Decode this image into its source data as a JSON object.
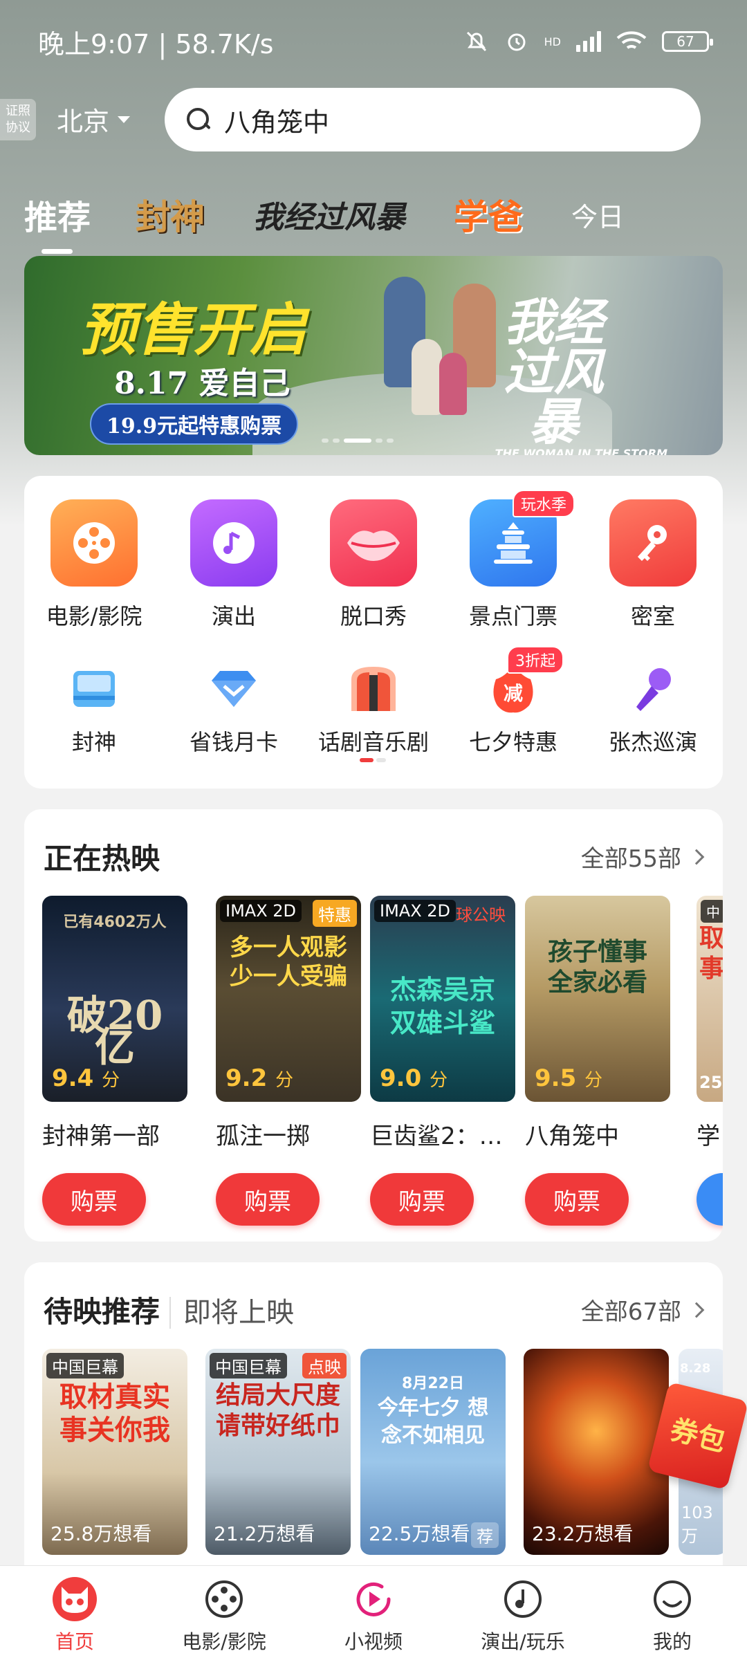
{
  "status_bar": {
    "time": "晚上9:07",
    "speed": "58.7K/s",
    "network": "HD",
    "battery": "67"
  },
  "header": {
    "license_line1": "证照",
    "license_line2": "协议",
    "city": "北京",
    "search_text": "八角笼中"
  },
  "tabs": {
    "active": "推荐",
    "logo1": "封神",
    "logo2": "我经过风暴",
    "logo3": "学爸",
    "today": "今日"
  },
  "banner": {
    "title": "预售开启",
    "subtitle": "8.17 爱自己",
    "price": "19.9元起特惠购票",
    "logo": "我经过风暴",
    "logo_en": "THE WOMAN IN THE STORM"
  },
  "services": {
    "row1": [
      {
        "label": "电影/影院",
        "icon": "film-reel-icon",
        "color": "#ff8a3d"
      },
      {
        "label": "演出",
        "icon": "music-note-icon",
        "color": "#a74ff2"
      },
      {
        "label": "脱口秀",
        "icon": "lips-icon",
        "color": "#f5455c"
      },
      {
        "label": "景点门票",
        "icon": "temple-icon",
        "color": "#3a8cf5",
        "badge": "玩水季"
      },
      {
        "label": "密室",
        "icon": "key-icon",
        "color": "#f2524a"
      }
    ],
    "row2": [
      {
        "label": "封神",
        "icon": "fengshen-icon"
      },
      {
        "label": "省钱月卡",
        "icon": "diamond-icon"
      },
      {
        "label": "话剧音乐剧",
        "icon": "curtain-icon"
      },
      {
        "label": "七夕特惠",
        "icon": "discount-icon",
        "badge": "3折起",
        "glyph": "减"
      },
      {
        "label": "张杰巡演",
        "icon": "microphone-icon"
      }
    ]
  },
  "now_showing": {
    "title": "正在热映",
    "more": "全部55部",
    "movies": [
      {
        "name": "封神第一部",
        "score": "9.4",
        "unit": "分",
        "poster_text": "破20亿",
        "poster_sub": "已有4602万人",
        "button": "购票"
      },
      {
        "name": "孤注一掷",
        "score": "9.2",
        "unit": "分",
        "tag": "IMAX 2D",
        "sale": "特惠",
        "poster_text": "多一人观影 少一人受骗",
        "button": "购票"
      },
      {
        "name": "巨齿鲨2：…",
        "score": "9.0",
        "unit": "分",
        "tag": "IMAX 2D",
        "sale": "球公映",
        "poster_text": "杰森吴京 双雄斗鲨",
        "button": "购票"
      },
      {
        "name": "八角笼中",
        "score": "9.5",
        "unit": "分",
        "poster_text": "孩子懂事 全家必看",
        "button": "购票"
      },
      {
        "name": "学",
        "score": "25",
        "tag": "中",
        "poster_text": "取事"
      }
    ]
  },
  "upcoming": {
    "title": "待映推荐",
    "subtitle": "即将上映",
    "more": "全部67部",
    "movies": [
      {
        "want": "25.8万想看",
        "tag": "中国巨幕",
        "poster_text": "取材真实 事关你我"
      },
      {
        "want": "21.2万想看",
        "tag": "中国巨幕",
        "tag2": "点映",
        "poster_text": "结局大尺度 请带好纸巾"
      },
      {
        "want": "22.5万想看",
        "tag3": "荐",
        "poster_text": "今年七夕 想念不如相见",
        "poster_date": "8月22日"
      },
      {
        "want": "23.2万想看"
      },
      {
        "want": "103万",
        "poster_date": "8.28"
      }
    ]
  },
  "coupon": "券包",
  "bottom_nav": [
    {
      "label": "首页",
      "icon": "cat-face-icon"
    },
    {
      "label": "电影/影院",
      "icon": "film-reel-icon"
    },
    {
      "label": "小视频",
      "icon": "play-icon"
    },
    {
      "label": "演出/玩乐",
      "icon": "music-disc-icon"
    },
    {
      "label": "我的",
      "icon": "profile-icon"
    }
  ]
}
